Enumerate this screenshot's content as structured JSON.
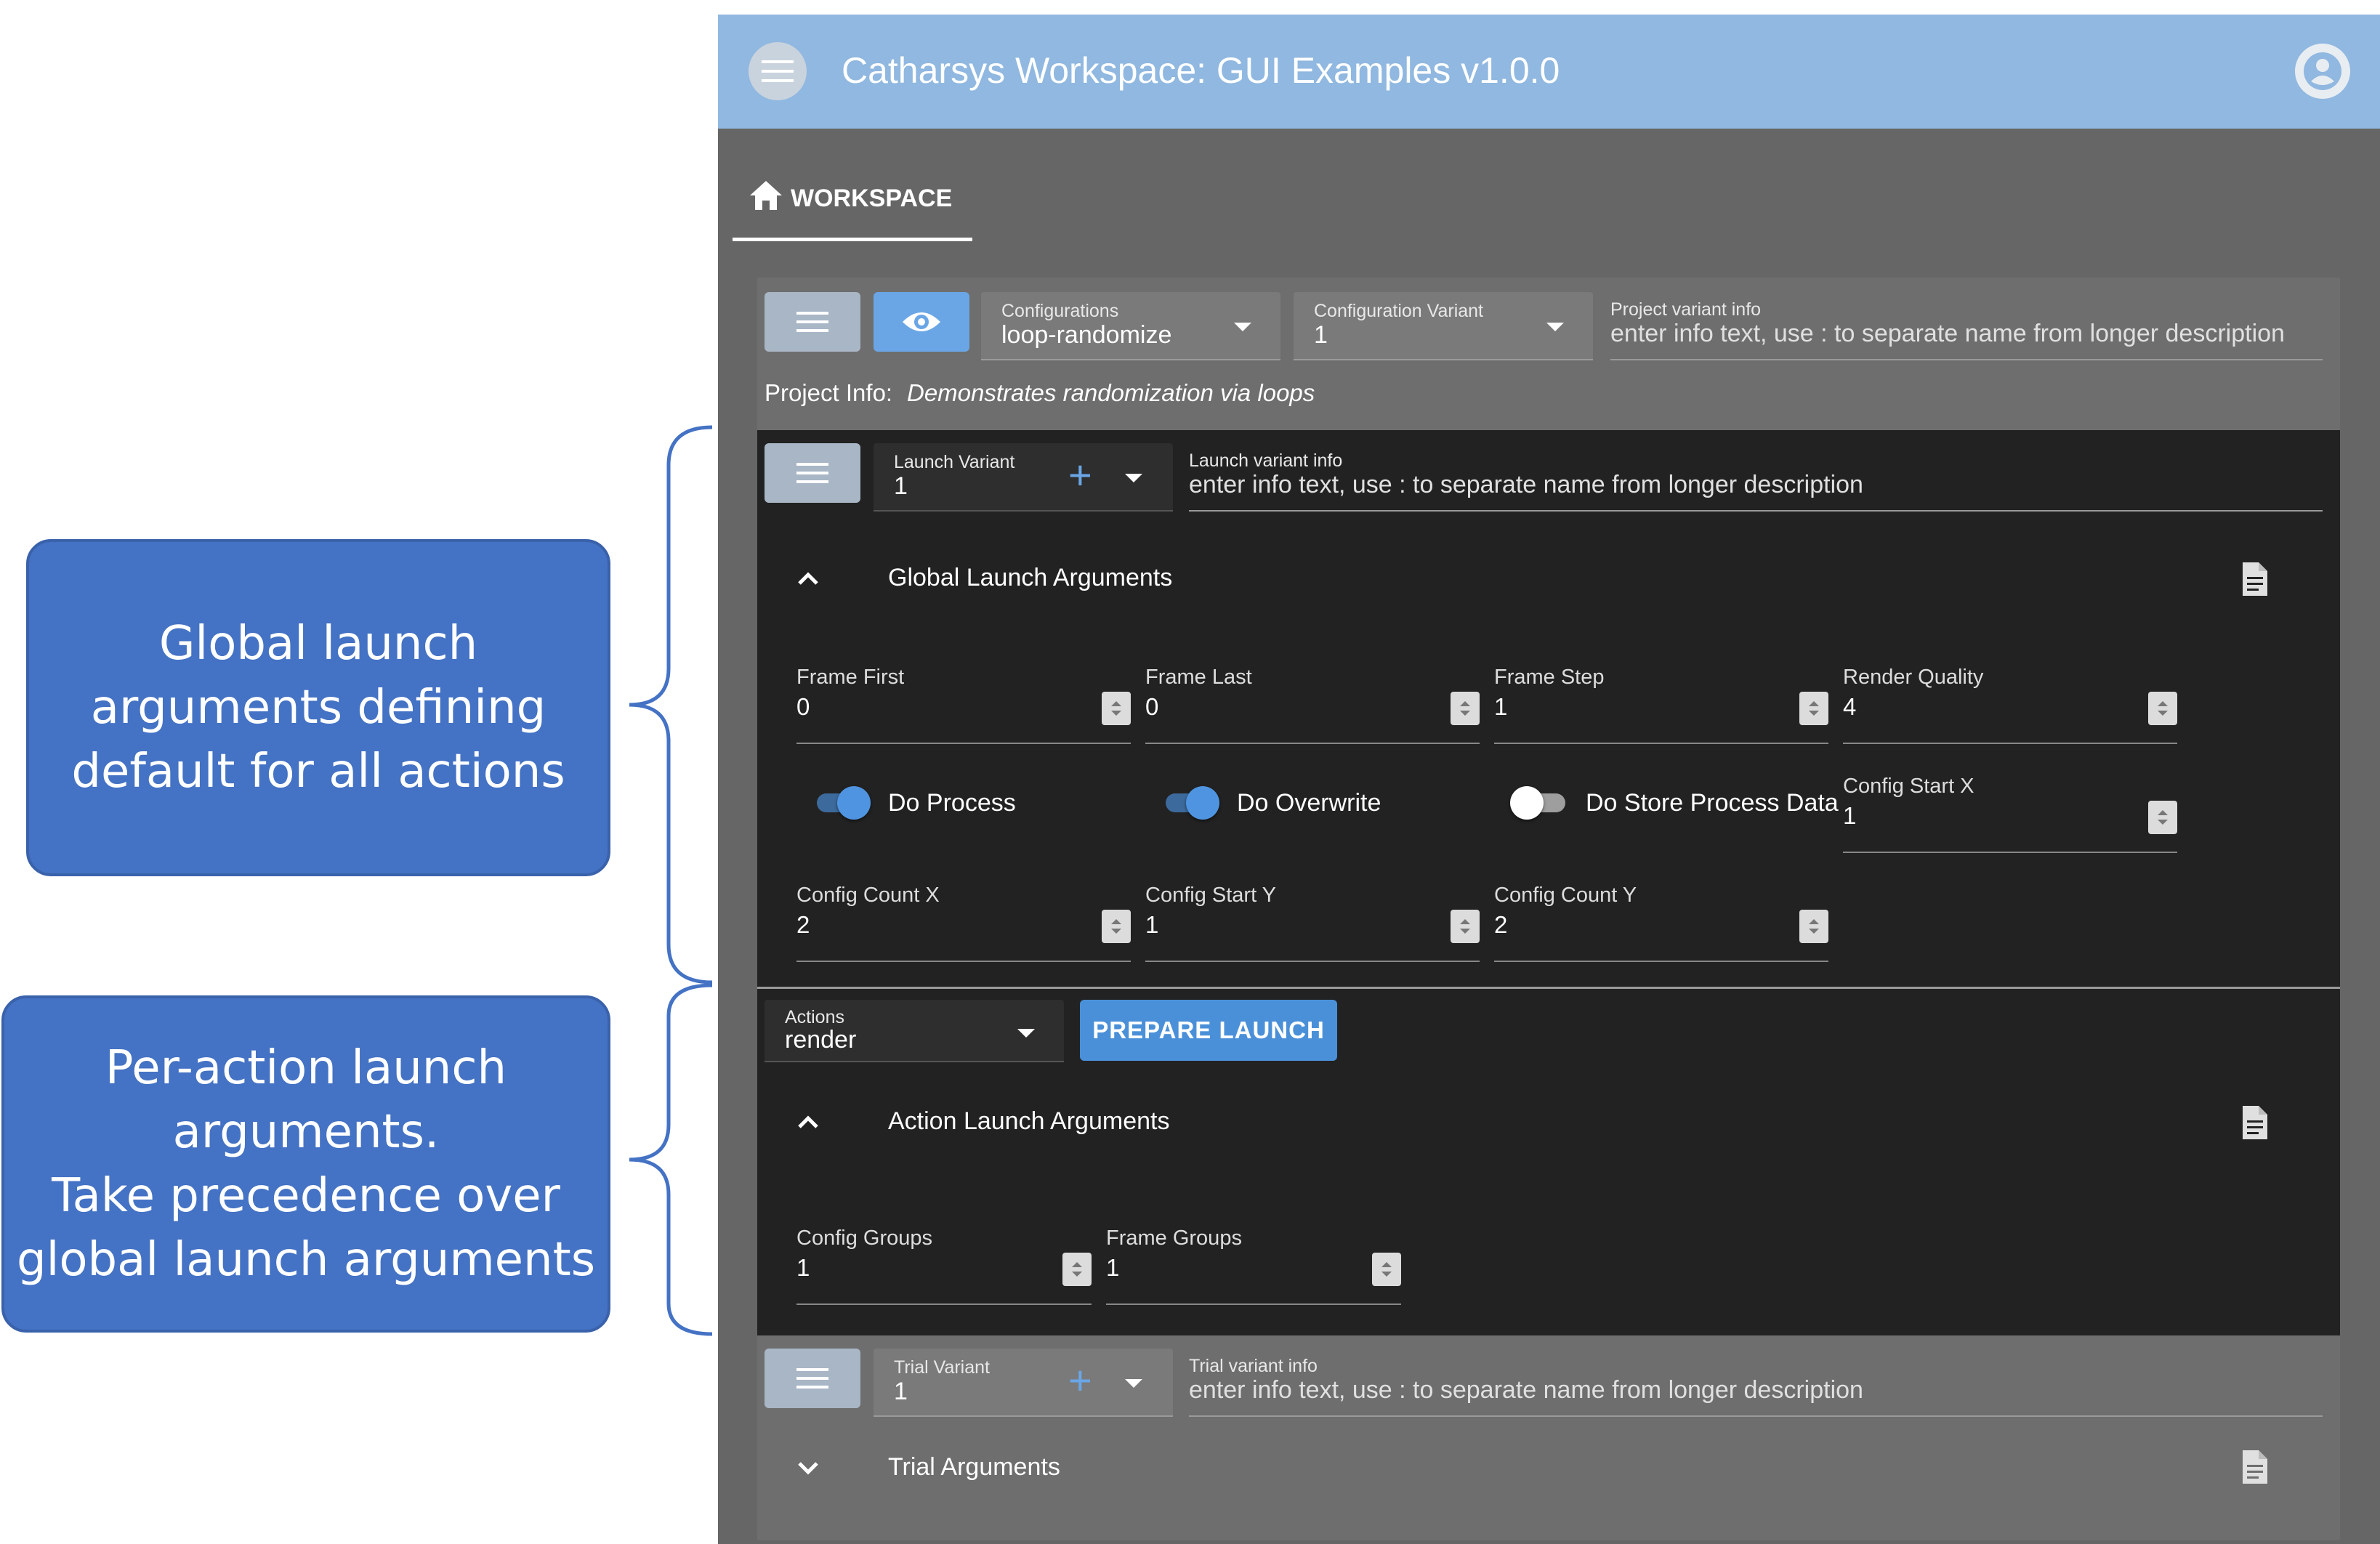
{
  "annotations": {
    "global": "Global launch\narguments defining\ndefault for all actions",
    "per_action": "Per-action launch\narguments.\nTake precedence over\nglobal launch arguments"
  },
  "app": {
    "title": "Catharsys Workspace: GUI Examples v1.0.0",
    "menu_icon": "hamburger-menu-icon",
    "account_icon": "account-circle-icon"
  },
  "tabs": [
    {
      "label": "WORKSPACE",
      "icon": "home-icon",
      "active": true
    }
  ],
  "project": {
    "configurations_caption": "Configurations",
    "configurations_value": "loop-randomize",
    "config_variant_caption": "Configuration Variant",
    "config_variant_value": "1",
    "variant_info_caption": "Project variant info",
    "variant_info_placeholder": "enter info text, use : to separate name from longer description",
    "info_label": "Project Info:",
    "info_text": "Demonstrates randomization via loops"
  },
  "launch": {
    "variant_caption": "Launch Variant",
    "variant_value": "1",
    "info_caption": "Launch variant info",
    "info_placeholder": "enter info text, use : to separate name from longer description",
    "global_title": "Global Launch Arguments",
    "fields": {
      "frame_first": {
        "label": "Frame First",
        "value": "0"
      },
      "frame_last": {
        "label": "Frame Last",
        "value": "0"
      },
      "frame_step": {
        "label": "Frame Step",
        "value": "1"
      },
      "render_quality": {
        "label": "Render Quality",
        "value": "4"
      },
      "config_start_x": {
        "label": "Config Start X",
        "value": "1"
      },
      "config_count_x": {
        "label": "Config Count X",
        "value": "2"
      },
      "config_start_y": {
        "label": "Config Start Y",
        "value": "1"
      },
      "config_count_y": {
        "label": "Config Count Y",
        "value": "2"
      }
    },
    "toggles": {
      "do_process": {
        "label": "Do Process",
        "on": true
      },
      "do_overwrite": {
        "label": "Do Overwrite",
        "on": true
      },
      "do_store": {
        "label": "Do Store Process Data",
        "on": false
      }
    }
  },
  "actions": {
    "caption": "Actions",
    "value": "render",
    "prepare_label": "PREPARE LAUNCH",
    "section_title": "Action Launch Arguments",
    "fields": {
      "config_groups": {
        "label": "Config Groups",
        "value": "1"
      },
      "frame_groups": {
        "label": "Frame Groups",
        "value": "1"
      }
    }
  },
  "trial": {
    "variant_caption": "Trial Variant",
    "variant_value": "1",
    "info_caption": "Trial variant info",
    "info_placeholder": "enter info text, use : to separate name from longer description",
    "section_title": "Trial Arguments"
  },
  "colors": {
    "appbar": "#90b8e0",
    "accent": "#4a90d9",
    "callout": "#4472c4",
    "dark_panel": "#222222"
  }
}
